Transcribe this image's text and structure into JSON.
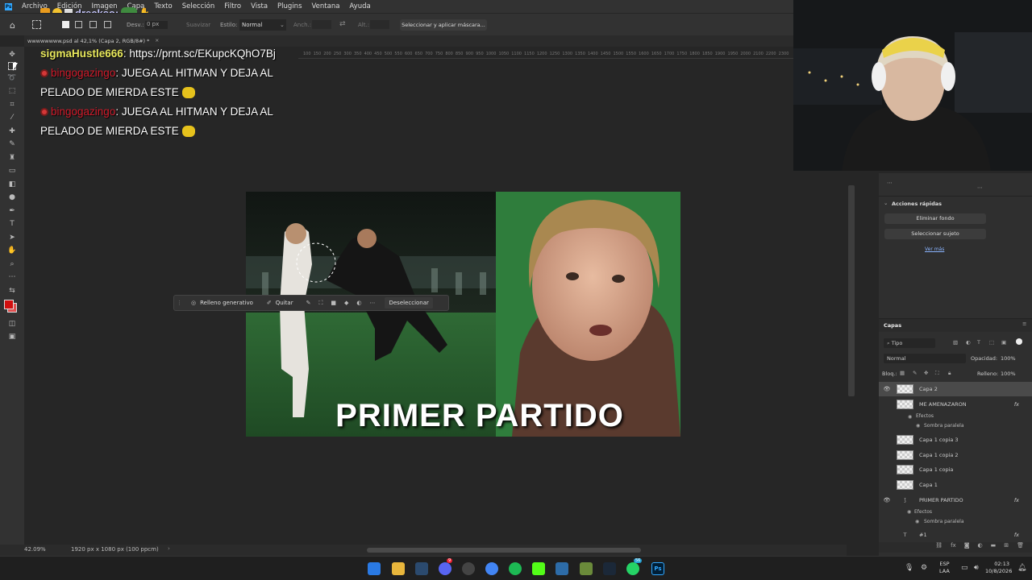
{
  "app": {
    "logo": "Ps"
  },
  "menu": [
    "Archivo",
    "Edición",
    "Imagen",
    "Capa",
    "Texto",
    "Selección",
    "Filtro",
    "Vista",
    "Plugins",
    "Ventana",
    "Ayuda"
  ],
  "stream_user": "drecksо:",
  "options_bar": {
    "feather_label": "Desv.:",
    "feather_value": "0 px",
    "smooth_label": "Suavizar",
    "style_label": "Estilo:",
    "style_value": "Normal",
    "width_label": "Anch.:",
    "height_label": "Alt.:",
    "mask_button": "Seleccionar y aplicar máscara..."
  },
  "document_tab": "wwwwwwww.psd al 42,1% (Capa 2, RGB/8#) *",
  "ruler_ticks": [
    "100",
    "150",
    "200",
    "250",
    "300",
    "350",
    "400",
    "450",
    "500",
    "550",
    "600",
    "650",
    "700",
    "750",
    "800",
    "850",
    "900",
    "950",
    "1000",
    "1050",
    "1100",
    "1150",
    "1200",
    "1250",
    "1300",
    "1350",
    "1400",
    "1450",
    "1500",
    "1550",
    "1600",
    "1650",
    "1700",
    "1750",
    "1800",
    "1850",
    "1900",
    "1950",
    "2000",
    "2100",
    "2200",
    "2300"
  ],
  "chat": [
    {
      "user": "sigmaHustle666",
      "sep": ":",
      "text": " https://prnt.sc/EKupcKQhO7Bj"
    },
    {
      "user": "bingogazingo",
      "sep": ":",
      "text": " JUEGA AL HITMAN Y DEJA AL PELADO DE MIERDA ESTE"
    },
    {
      "user": "bingogazingo",
      "sep": ":",
      "text": " JUEGA AL HITMAN Y DEJA AL PELADO DE MIERDA ESTE"
    }
  ],
  "contextual_bar": {
    "generative_fill": "Relleno generativo",
    "remove": "Quitar",
    "deselect": "Deseleccionar"
  },
  "image_caption": "PRIMER PARTIDO",
  "status": {
    "zoom": "42.09%",
    "doc_size": "1920 px x 1080 px (100 ppcm)"
  },
  "quick_actions": {
    "title": "Acciones rápidas",
    "remove_bg": "Eliminar fondo",
    "select_subject": "Seleccionar sujeto",
    "see_more": "Ver más"
  },
  "layers_panel": {
    "title": "Capas",
    "filter": "Tipo",
    "blend_mode": "Normal",
    "opacity_label": "Opacidad:",
    "opacity_value": "100%",
    "lock_label": "Bloq.:",
    "fill_label": "Relleno:",
    "fill_value": "100%",
    "layers": [
      {
        "name": "Capa 2",
        "visible": true,
        "selected": true
      },
      {
        "name": "ME AMENAZARON",
        "visible": false,
        "fx": "fx",
        "effects_label": "Efectos",
        "effect": "Sombra paralela"
      },
      {
        "name": "Capa 1 copia 3",
        "visible": false
      },
      {
        "name": "Capa 1 copia 2",
        "visible": false
      },
      {
        "name": "Capa 1 copia",
        "visible": false
      },
      {
        "name": "Capa 1",
        "visible": false
      },
      {
        "name": "PRIMER PARTIDO",
        "visible": true,
        "fx": "fx",
        "effects_label": "Efectos",
        "effect": "Sombra paralela"
      },
      {
        "name": "#1",
        "visible": false,
        "fx": "fx"
      }
    ]
  },
  "taskbar": {
    "lang_top": "ESP",
    "lang_bottom": "LAA",
    "time": "02:13",
    "date": "10/8/2026",
    "badge_discord": "9",
    "badge_whatsapp": "56"
  },
  "colors": {
    "foreground": "#d10f0f",
    "background": "#e05050",
    "accent": "#31a8ff"
  }
}
